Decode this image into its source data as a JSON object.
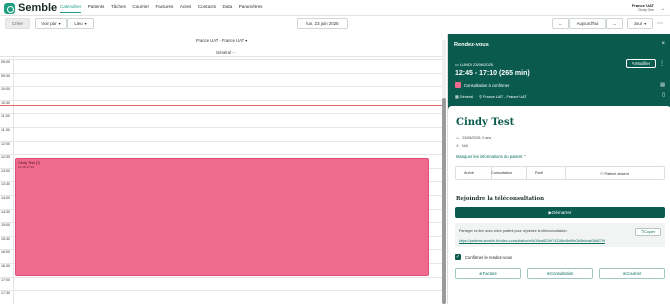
{
  "app": {
    "brand": "Semble"
  },
  "nav": {
    "items": [
      "Calendrier",
      "Patients",
      "Tâches",
      "Courrier",
      "Factures",
      "Actes",
      "Contacts",
      "Data",
      "Paramètres"
    ]
  },
  "user": {
    "org": "France UAT",
    "name": "Cindy Gee"
  },
  "toolbar": {
    "create": "Créer",
    "view": "Voir par",
    "place": "Lieu",
    "date": "lun. 23 juin 2025",
    "prev": "←",
    "today": "Aujourd'hui",
    "next": "→",
    "mode": "Jour",
    "more": "⋯"
  },
  "calendar": {
    "location": "France UAT - France UAT",
    "column": "Général",
    "column_more": "⋯",
    "times": [
      "09:00",
      "09:30",
      "10:00",
      "10:30",
      "11:00",
      "11:30",
      "12:00",
      "12:30",
      "13:00",
      "13:30",
      "14:00",
      "14:30",
      "15:00",
      "15:30",
      "16:00",
      "16:30",
      "17:00",
      "17:30"
    ],
    "appointment": {
      "title": "Cindy Test (?)",
      "time": "12:45-17:10"
    }
  },
  "panel": {
    "title": "Rendez-vous",
    "close": "×",
    "date": "LUNDI 23/06/2025",
    "time": "12:45 - 17:10  (265 min)",
    "edit": "Modifier",
    "status": "Consultation à confirmer",
    "room": "Général",
    "location": "France UAT - France UAT",
    "patient_name": "Cindy Test",
    "dob": "23/06/2025, 0 ans",
    "phone": "N/A",
    "hide_info": "Masquer les informations du patient",
    "steps": [
      "Arrivé",
      "Consultation",
      "Parti",
      "Patient absent"
    ],
    "tele_title": "Rejoindre la téléconsultation",
    "start": "Démarrer",
    "share_text": "Partager ce lien avec votre patient pour rejoindre la téléconsultation.",
    "copy": "Copier",
    "url": "https://patients.semble.fr/video-consultation/e0d19ea822bf7431f8e4bdf9e2b5bdcab38d279f",
    "confirm": "Confirmer le rendez-vous",
    "actions": [
      "Facture",
      "Consultation",
      "Courrier"
    ]
  },
  "colors": {
    "brand": "#1f9d82",
    "panel": "#0a5b4e",
    "appointment": "#f06a8d"
  }
}
